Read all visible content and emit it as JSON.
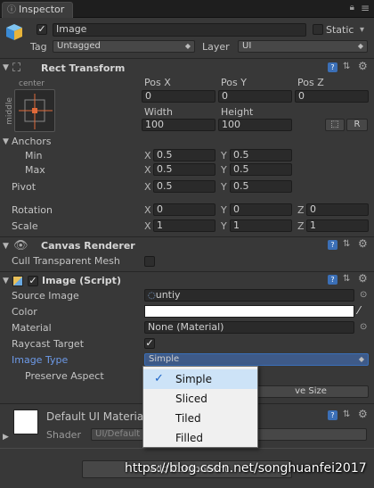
{
  "tab": {
    "title": "Inspector"
  },
  "header": {
    "name": "Image",
    "static_label": "Static",
    "tag_label": "Tag",
    "tag_value": "Untagged",
    "layer_label": "Layer",
    "layer_value": "UI"
  },
  "rect_transform": {
    "title": "Rect Transform",
    "preset_top": "center",
    "preset_side": "middle",
    "pos_x_label": "Pos X",
    "pos_y_label": "Pos Y",
    "pos_z_label": "Pos Z",
    "pos_x": "0",
    "pos_y": "0",
    "pos_z": "0",
    "width_label": "Width",
    "height_label": "Height",
    "width": "100",
    "height": "100",
    "raw_button": "R",
    "anchors_label": "Anchors",
    "min_label": "Min",
    "max_label": "Max",
    "min_x": "0.5",
    "min_y": "0.5",
    "max_x": "0.5",
    "max_y": "0.5",
    "pivot_label": "Pivot",
    "pivot_x": "0.5",
    "pivot_y": "0.5",
    "rotation_label": "Rotation",
    "rot_x": "0",
    "rot_y": "0",
    "rot_z": "0",
    "scale_label": "Scale",
    "scale_x": "1",
    "scale_y": "1",
    "scale_z": "1",
    "axis_x": "X",
    "axis_y": "Y",
    "axis_z": "Z"
  },
  "canvas_renderer": {
    "title": "Canvas Renderer",
    "cull_label": "Cull Transparent Mesh"
  },
  "image_script": {
    "title": "Image (Script)",
    "source_label": "Source Image",
    "source_value": "untiy",
    "color_label": "Color",
    "material_label": "Material",
    "material_value": "None (Material)",
    "raycast_label": "Raycast Target",
    "image_type_label": "Image Type",
    "image_type_value": "Simple",
    "preserve_label": "Preserve Aspect",
    "native_size_partial": "ve Size"
  },
  "material_section": {
    "title": "Default UI Materia",
    "shader_label": "Shader",
    "shader_value": "UI/Default"
  },
  "bottom_button_partial": "Add Component",
  "dropdown_options": [
    {
      "label": "Simple",
      "selected": true
    },
    {
      "label": "Sliced",
      "selected": false
    },
    {
      "label": "Tiled",
      "selected": false
    },
    {
      "label": "Filled",
      "selected": false
    }
  ],
  "watermark": "https://blog.csdn.net/songhuanfei2017",
  "colors": {
    "panel": "#383838",
    "field": "#2a2a2a",
    "accent_blue": "#6d9ae8",
    "color_swatch": "#ffffff"
  }
}
